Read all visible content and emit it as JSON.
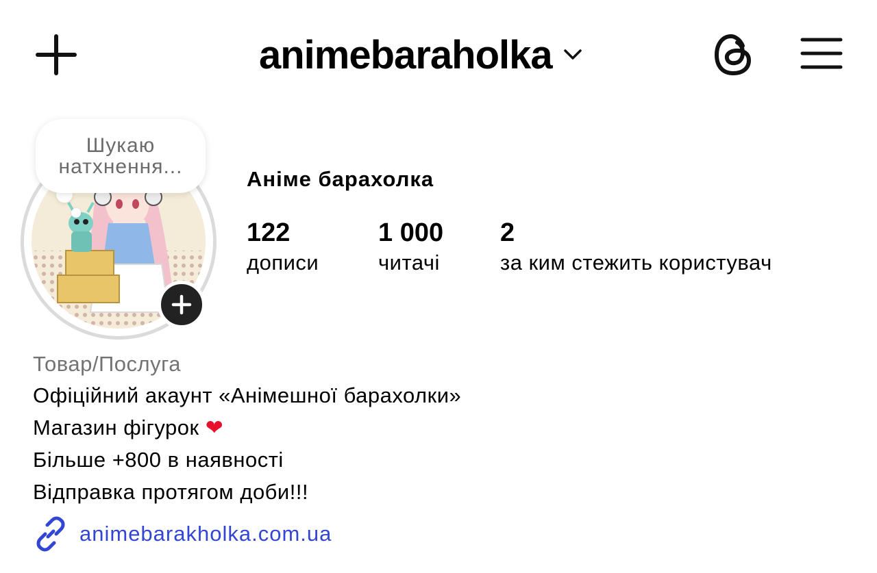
{
  "header": {
    "username": "animebaraholka",
    "icons": {
      "add": "plus-icon",
      "switch_account": "chevron-down-icon",
      "threads": "threads-icon",
      "menu": "hamburger-menu-icon"
    }
  },
  "profile": {
    "note": "Шукаю натхнення...",
    "display_name": "Аніме барахолка",
    "stats": [
      {
        "value": "122",
        "label": "дописи"
      },
      {
        "value": "1 000",
        "label": "читачі"
      },
      {
        "value": "2",
        "label": "за ким стежить користувач"
      }
    ]
  },
  "bio": {
    "category": "Товар/Послуга",
    "lines": [
      "Офіційний акаунт «Анімешної барахолки»",
      "Магазин фігурок",
      "Більше +800 в наявності",
      "Відправка протягом доби!!!"
    ],
    "heart_emoji": "❤"
  },
  "link": {
    "text": "animebarakholka.com.ua",
    "icon": "link-icon"
  },
  "colors": {
    "link": "#3346d3",
    "category": "#737373",
    "heart": "#e8112d",
    "add_story_badge": "#222222"
  }
}
